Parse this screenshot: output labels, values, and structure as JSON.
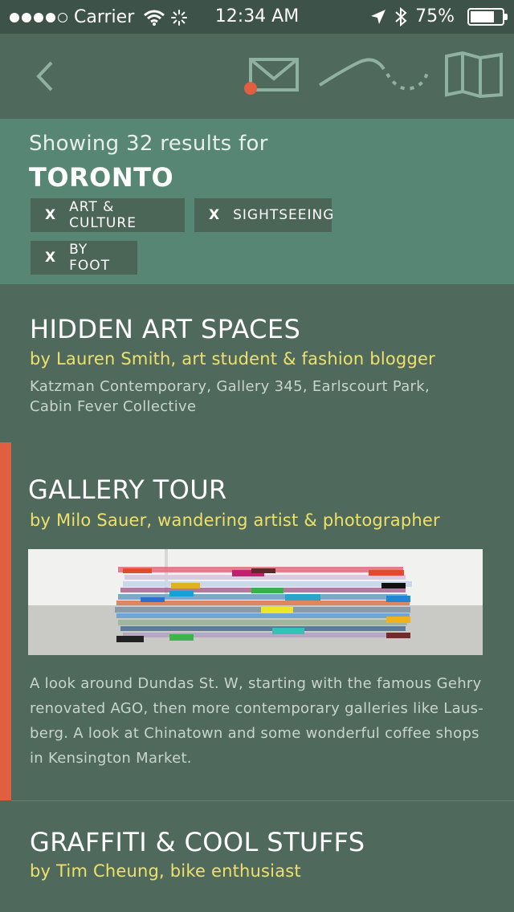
{
  "status_bar": {
    "carrier": "Carrier",
    "time": "12:34 AM",
    "battery": "75%",
    "battery_level": 0.75,
    "signal_icon": "signal-dots-icon",
    "wifi_icon": "wifi-icon",
    "activity_icon": "spinner-icon",
    "location_icon": "location-arrow-icon",
    "bluetooth_icon": "bluetooth-icon"
  },
  "nav": {
    "back_icon": "chevron-left-icon",
    "mail_icon": "envelope-icon",
    "route_icon": "route-icon",
    "map_icon": "map-icon",
    "accent_color": "#df5f40"
  },
  "filters": {
    "showing_text": "Showing 32 results for",
    "city": "TORONTO",
    "chips": [
      {
        "remove": "X",
        "label": "ART & CULTURE"
      },
      {
        "remove": "X",
        "label": "SIGHTSEEING"
      },
      {
        "remove": "X",
        "label": "BY FOOT"
      }
    ]
  },
  "results": [
    {
      "title": "HIDDEN ART SPACES",
      "author": "by Lauren Smith, art student & fashion blogger",
      "description": "Katzman Contemporary, Gallery 345, Earlscourt Park, Cabin Fever Collective"
    },
    {
      "title": "GALLERY TOUR",
      "author": "by Milo Sauer, wandering artist & photographer",
      "description": "A look around Dundas St. W, starting with the famous Gehry renovated AGO, then more contemporary galleries like Laus-berg. A look at Chinatown and some wonderful coffee shops in Kensington Market.",
      "selected": true
    },
    {
      "title": "GRAFFITI & COOL STUFFS",
      "author": "by Tim Cheung, bike enthusiast"
    }
  ],
  "colors": {
    "header": "#4f6a5d",
    "filter_panel": "#588675",
    "author": "#efe06a",
    "selected_accent": "#df5f40"
  }
}
